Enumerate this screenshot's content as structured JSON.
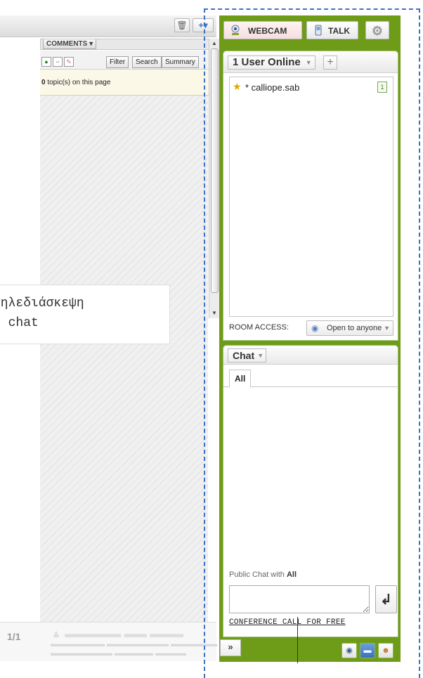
{
  "comments_panel": {
    "tab_label": "COMMENTS ▾",
    "toolbar_tabs": [
      "Filter",
      "Search",
      "Summary"
    ],
    "topic_count": "0",
    "topic_suffix": " topic(s) on this page",
    "trash_icon": "trash-icon",
    "add_icon": "add-dropdown-icon"
  },
  "annotation": {
    "line1": "Τηλεδιάσκεψη",
    "line2": "- chat"
  },
  "page_nav": {
    "page_indicator": "1/1"
  },
  "toolbar": {
    "webcam_label": "WEBCAM",
    "talk_label": "TALK",
    "settings_icon": "gear-icon"
  },
  "users": {
    "header": "1 User Online",
    "list": [
      {
        "name": "* calliope.sab",
        "badge": "1",
        "icon": "star-icon"
      }
    ],
    "room_access_label": "ROOM ACCESS:",
    "room_access_value": "Open to anyone"
  },
  "chat": {
    "header": "Chat",
    "tabs": [
      "All"
    ],
    "public_chat_prefix": "Public Chat with ",
    "public_chat_target": "All",
    "input_value": "",
    "send_icon": "enter-icon",
    "conference_link": "CONFERENCE CALL FOR FREE"
  },
  "bottom_bar": {
    "expand_label": "»",
    "icons": [
      "webcam-small-icon",
      "chat-bubble-icon",
      "user-icon"
    ]
  },
  "colors": {
    "panel_green": "#6e9c19",
    "dashed_blue": "#3b73c6",
    "webcam_bg": "#f5dede"
  }
}
